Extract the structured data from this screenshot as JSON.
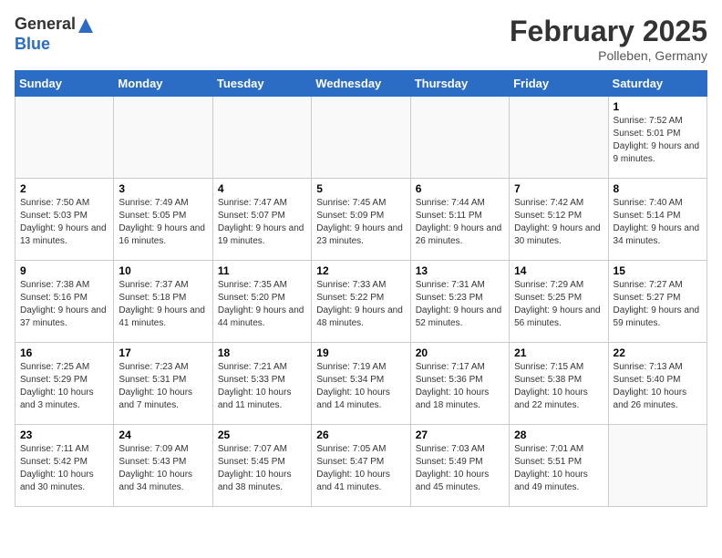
{
  "header": {
    "logo_general": "General",
    "logo_blue": "Blue",
    "month_year": "February 2025",
    "location": "Polleben, Germany"
  },
  "weekdays": [
    "Sunday",
    "Monday",
    "Tuesday",
    "Wednesday",
    "Thursday",
    "Friday",
    "Saturday"
  ],
  "weeks": [
    [
      {
        "day": "",
        "info": ""
      },
      {
        "day": "",
        "info": ""
      },
      {
        "day": "",
        "info": ""
      },
      {
        "day": "",
        "info": ""
      },
      {
        "day": "",
        "info": ""
      },
      {
        "day": "",
        "info": ""
      },
      {
        "day": "1",
        "info": "Sunrise: 7:52 AM\nSunset: 5:01 PM\nDaylight: 9 hours and 9 minutes."
      }
    ],
    [
      {
        "day": "2",
        "info": "Sunrise: 7:50 AM\nSunset: 5:03 PM\nDaylight: 9 hours and 13 minutes."
      },
      {
        "day": "3",
        "info": "Sunrise: 7:49 AM\nSunset: 5:05 PM\nDaylight: 9 hours and 16 minutes."
      },
      {
        "day": "4",
        "info": "Sunrise: 7:47 AM\nSunset: 5:07 PM\nDaylight: 9 hours and 19 minutes."
      },
      {
        "day": "5",
        "info": "Sunrise: 7:45 AM\nSunset: 5:09 PM\nDaylight: 9 hours and 23 minutes."
      },
      {
        "day": "6",
        "info": "Sunrise: 7:44 AM\nSunset: 5:11 PM\nDaylight: 9 hours and 26 minutes."
      },
      {
        "day": "7",
        "info": "Sunrise: 7:42 AM\nSunset: 5:12 PM\nDaylight: 9 hours and 30 minutes."
      },
      {
        "day": "8",
        "info": "Sunrise: 7:40 AM\nSunset: 5:14 PM\nDaylight: 9 hours and 34 minutes."
      }
    ],
    [
      {
        "day": "9",
        "info": "Sunrise: 7:38 AM\nSunset: 5:16 PM\nDaylight: 9 hours and 37 minutes."
      },
      {
        "day": "10",
        "info": "Sunrise: 7:37 AM\nSunset: 5:18 PM\nDaylight: 9 hours and 41 minutes."
      },
      {
        "day": "11",
        "info": "Sunrise: 7:35 AM\nSunset: 5:20 PM\nDaylight: 9 hours and 44 minutes."
      },
      {
        "day": "12",
        "info": "Sunrise: 7:33 AM\nSunset: 5:22 PM\nDaylight: 9 hours and 48 minutes."
      },
      {
        "day": "13",
        "info": "Sunrise: 7:31 AM\nSunset: 5:23 PM\nDaylight: 9 hours and 52 minutes."
      },
      {
        "day": "14",
        "info": "Sunrise: 7:29 AM\nSunset: 5:25 PM\nDaylight: 9 hours and 56 minutes."
      },
      {
        "day": "15",
        "info": "Sunrise: 7:27 AM\nSunset: 5:27 PM\nDaylight: 9 hours and 59 minutes."
      }
    ],
    [
      {
        "day": "16",
        "info": "Sunrise: 7:25 AM\nSunset: 5:29 PM\nDaylight: 10 hours and 3 minutes."
      },
      {
        "day": "17",
        "info": "Sunrise: 7:23 AM\nSunset: 5:31 PM\nDaylight: 10 hours and 7 minutes."
      },
      {
        "day": "18",
        "info": "Sunrise: 7:21 AM\nSunset: 5:33 PM\nDaylight: 10 hours and 11 minutes."
      },
      {
        "day": "19",
        "info": "Sunrise: 7:19 AM\nSunset: 5:34 PM\nDaylight: 10 hours and 14 minutes."
      },
      {
        "day": "20",
        "info": "Sunrise: 7:17 AM\nSunset: 5:36 PM\nDaylight: 10 hours and 18 minutes."
      },
      {
        "day": "21",
        "info": "Sunrise: 7:15 AM\nSunset: 5:38 PM\nDaylight: 10 hours and 22 minutes."
      },
      {
        "day": "22",
        "info": "Sunrise: 7:13 AM\nSunset: 5:40 PM\nDaylight: 10 hours and 26 minutes."
      }
    ],
    [
      {
        "day": "23",
        "info": "Sunrise: 7:11 AM\nSunset: 5:42 PM\nDaylight: 10 hours and 30 minutes."
      },
      {
        "day": "24",
        "info": "Sunrise: 7:09 AM\nSunset: 5:43 PM\nDaylight: 10 hours and 34 minutes."
      },
      {
        "day": "25",
        "info": "Sunrise: 7:07 AM\nSunset: 5:45 PM\nDaylight: 10 hours and 38 minutes."
      },
      {
        "day": "26",
        "info": "Sunrise: 7:05 AM\nSunset: 5:47 PM\nDaylight: 10 hours and 41 minutes."
      },
      {
        "day": "27",
        "info": "Sunrise: 7:03 AM\nSunset: 5:49 PM\nDaylight: 10 hours and 45 minutes."
      },
      {
        "day": "28",
        "info": "Sunrise: 7:01 AM\nSunset: 5:51 PM\nDaylight: 10 hours and 49 minutes."
      },
      {
        "day": "",
        "info": ""
      }
    ]
  ]
}
